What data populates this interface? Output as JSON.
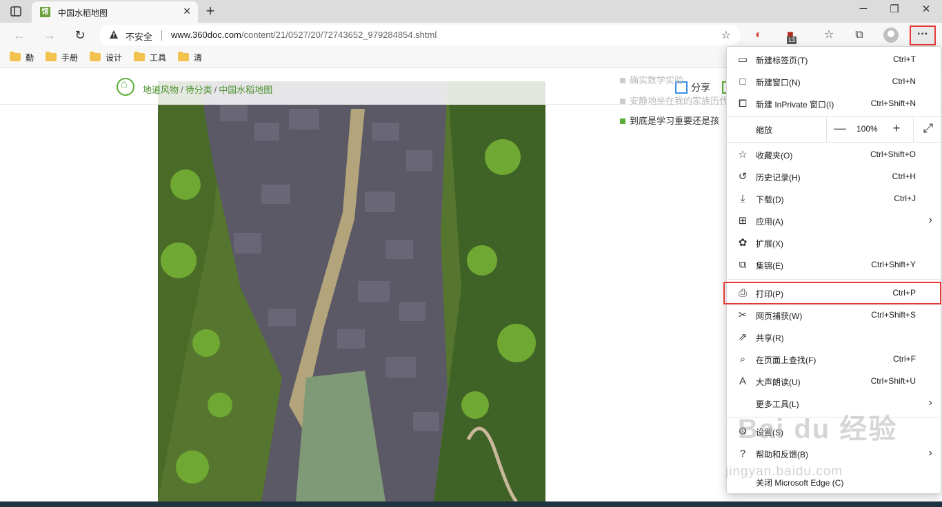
{
  "tab": {
    "favicon": "馆",
    "title": "中国水稻地图",
    "close": "✕"
  },
  "window": {
    "minimize": "─",
    "restore": "❐",
    "close": "✕"
  },
  "toolbar": {
    "security_label": "不安全",
    "url_host": "www.360doc.com",
    "url_path": "/content/21/0527/20/72743652_979284854.shtml",
    "extension_badge": "13",
    "more_label": "···"
  },
  "bookmarks": [
    "勤",
    "手册",
    "设计",
    "工具",
    "清"
  ],
  "page": {
    "breadcrumb": [
      "地道风物",
      "待分类",
      "中国水稻地图"
    ],
    "share_label": "分享",
    "side_items": [
      "确实数学实验",
      "安静地坐在我的家族历代",
      "到底是学习重要还是孩"
    ]
  },
  "menu": {
    "items_top": [
      {
        "icon": "new-tab-icon",
        "label": "新建标签页(T)",
        "shortcut": "Ctrl+T"
      },
      {
        "icon": "new-window-icon",
        "label": "新建窗口(N)",
        "shortcut": "Ctrl+N"
      },
      {
        "icon": "inprivate-icon",
        "label": "新建 InPrivate 窗口(I)",
        "shortcut": "Ctrl+Shift+N"
      }
    ],
    "zoom": {
      "label": "缩放",
      "minus": "—",
      "value": "100%",
      "plus": "+",
      "fullscreen": "⤢"
    },
    "items_mid": [
      {
        "icon": "favorites-icon",
        "label": "收藏夹(O)",
        "shortcut": "Ctrl+Shift+O"
      },
      {
        "icon": "history-icon",
        "label": "历史记录(H)",
        "shortcut": "Ctrl+H"
      },
      {
        "icon": "download-icon",
        "label": "下载(D)",
        "shortcut": "Ctrl+J"
      },
      {
        "icon": "apps-icon",
        "label": "应用(A)",
        "shortcut": "",
        "submenu": true
      },
      {
        "icon": "extensions-icon",
        "label": "扩展(X)",
        "shortcut": ""
      },
      {
        "icon": "collections-icon",
        "label": "集锦(E)",
        "shortcut": "Ctrl+Shift+Y"
      }
    ],
    "items_bottom": [
      {
        "icon": "print-icon",
        "label": "打印(P)",
        "shortcut": "Ctrl+P"
      },
      {
        "icon": "web-capture-icon",
        "label": "网页捕获(W)",
        "shortcut": "Ctrl+Shift+S"
      },
      {
        "icon": "share-icon",
        "label": "共享(R)",
        "shortcut": ""
      },
      {
        "icon": "find-icon",
        "label": "在页面上查找(F)",
        "shortcut": "Ctrl+F"
      },
      {
        "icon": "read-aloud-icon",
        "label": "大声朗读(U)",
        "shortcut": "Ctrl+Shift+U"
      },
      {
        "icon": "",
        "label": "更多工具(L)",
        "shortcut": "",
        "submenu": true
      }
    ],
    "items_end": [
      {
        "icon": "settings-icon",
        "label": "设置(S)",
        "shortcut": ""
      },
      {
        "icon": "help-icon",
        "label": "帮助和反馈(B)",
        "shortcut": "",
        "submenu": true
      },
      {
        "icon": "",
        "label": "关闭 Microsoft Edge (C)",
        "shortcut": ""
      }
    ]
  },
  "watermark": {
    "main": "Bai du 经验",
    "sub": "jingyan.baidu.com"
  }
}
